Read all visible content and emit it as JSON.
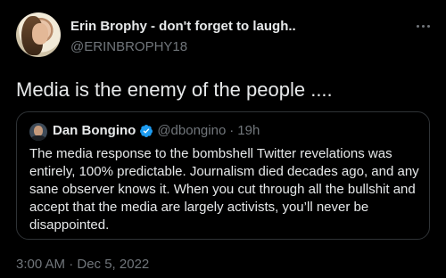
{
  "author": {
    "display_name": "Erin Brophy - don't forget to laugh..",
    "handle": "@ERINBROPHY18"
  },
  "tweet": {
    "text": "Media is the enemy of the people ....",
    "timestamp": "3:00 AM · Dec 5, 2022"
  },
  "quoted_tweet": {
    "display_name": "Dan Bongino",
    "handle": "@dbongino",
    "separator": "·",
    "time": "19h",
    "verified": true,
    "lines": [
      "The media response to the bombshell Twitter revelations was",
      "entirely, 100% predictable. Journalism died decades ago, and any",
      "sane observer knows it. When you cut through all the bullshit and",
      "accept that the media are largely activists, you’ll never be",
      "disappointed."
    ]
  },
  "icons": {
    "more": "more-horizontal-icon",
    "verified": "verified-badge-icon"
  },
  "colors": {
    "background": "#000000",
    "primary_text": "#e7e9ea",
    "secondary_text": "#71767b",
    "border": "#2f3336",
    "verified_blue": "#1d9bf0"
  }
}
